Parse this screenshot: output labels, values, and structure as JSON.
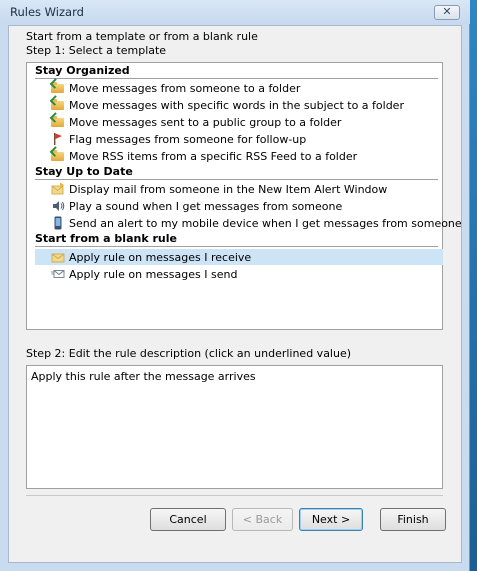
{
  "window": {
    "title": "Rules Wizard",
    "close_glyph": "✕"
  },
  "intro": {
    "line1": "Start from a template or from a blank rule",
    "line2": "Step 1: Select a template"
  },
  "groups": [
    {
      "header": "Stay Organized",
      "items": [
        {
          "label": "Move messages from someone to a folder",
          "icon": "folder-arrow-icon"
        },
        {
          "label": "Move messages with specific words in the subject to a folder",
          "icon": "folder-arrow-icon"
        },
        {
          "label": "Move messages sent to a public group to a folder",
          "icon": "folder-arrow-icon"
        },
        {
          "label": "Flag messages from someone for follow-up",
          "icon": "red-flag-icon"
        },
        {
          "label": "Move RSS items from a specific RSS Feed to a folder",
          "icon": "folder-arrow-icon"
        }
      ]
    },
    {
      "header": "Stay Up to Date",
      "items": [
        {
          "label": "Display mail from someone in the New Item Alert Window",
          "icon": "envelope-alert-icon"
        },
        {
          "label": "Play a sound when I get messages from someone",
          "icon": "speaker-icon"
        },
        {
          "label": "Send an alert to my mobile device when I get messages from someone",
          "icon": "mobile-device-icon"
        }
      ]
    },
    {
      "header": "Start from a blank rule",
      "items": [
        {
          "label": "Apply rule on messages I receive",
          "icon": "envelope-receive-icon",
          "selected": true
        },
        {
          "label": "Apply rule on messages I send",
          "icon": "envelope-send-icon"
        }
      ]
    }
  ],
  "step2": {
    "label": "Step 2: Edit the rule description (click an underlined value)",
    "description": "Apply this rule after the message arrives"
  },
  "buttons": {
    "cancel": "Cancel",
    "back": "< Back",
    "next": "Next >",
    "finish": "Finish"
  },
  "colors": {
    "selection": "#cde3f6",
    "flag": "#d9342b",
    "folder": "#e9b85a"
  }
}
